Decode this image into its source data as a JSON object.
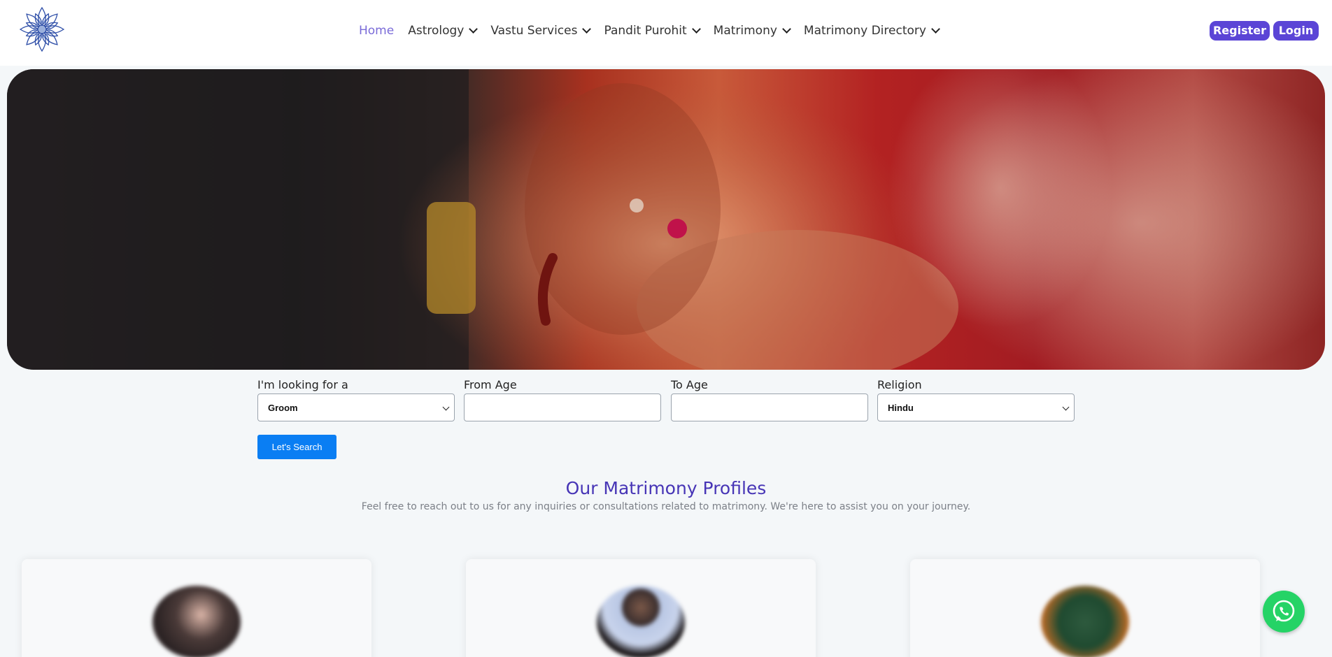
{
  "nav": {
    "items": [
      {
        "label": "Home",
        "active": true,
        "dropdown": false
      },
      {
        "label": "Astrology",
        "dropdown": true
      },
      {
        "label": "Vastu Services",
        "dropdown": true
      },
      {
        "label": "Pandit Purohit",
        "dropdown": true
      },
      {
        "label": "Matrimony",
        "dropdown": true
      },
      {
        "label": "Matrimony Directory",
        "dropdown": true
      }
    ],
    "register_label": "Register",
    "login_label": "Login"
  },
  "search": {
    "looking_for": {
      "label": "I'm looking for a",
      "value": "Groom"
    },
    "from_age": {
      "label": "From Age",
      "value": ""
    },
    "to_age": {
      "label": "To Age",
      "value": ""
    },
    "religion": {
      "label": "Religion",
      "value": "Hindu"
    },
    "submit_label": "Let's Search"
  },
  "profiles": {
    "title": "Our Matrimony Profiles",
    "subtitle": "Feel free to reach out to us for any inquiries or consultations related to matrimony. We're here to assist you on your journey."
  },
  "icons": {
    "logo": "mandala-logo-icon",
    "whatsapp": "whatsapp-icon",
    "chevron": "chevron-down-icon"
  },
  "colors": {
    "accent": "#5b45d6",
    "nav_active": "#7a6bd8",
    "search_button": "#0a7ef3",
    "section_title": "#4735b6",
    "whatsapp": "#25d366"
  }
}
